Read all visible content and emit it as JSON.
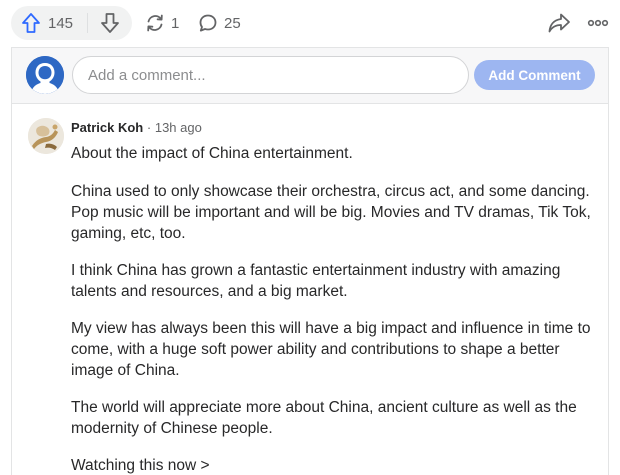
{
  "actions": {
    "upvote_count": "145",
    "share_count": "1",
    "comment_count": "25"
  },
  "composer": {
    "placeholder": "Add a comment...",
    "button_label": "Add Comment"
  },
  "comment": {
    "author": "Patrick Koh",
    "separator": "·",
    "time": "13h ago",
    "paragraphs": [
      "About the impact of China entertainment.",
      "China used to only showcase their orchestra, circus act, and some dancing. Pop music will be important and will be big. Movies and TV dramas, Tik Tok, gaming, etc, too.",
      "I think China has grown a fantastic entertainment industry with amazing talents and resources, and a big market.",
      "My view has always been this will have a big impact and influence in time to come, with a huge soft power ability and contributions to shape a better image of China.",
      "The world will appreciate more about China, ancient culture as well as the modernity of Chinese people."
    ],
    "watch_link": "Watching this now >"
  },
  "icons": {
    "upvote": "arrow-up-icon",
    "downvote": "arrow-down-icon",
    "share": "reshare-icon",
    "comments": "comment-bubble-icon",
    "forward": "share-arrow-icon",
    "more": "more-dots-icon"
  },
  "colors": {
    "accent": "#2e69ff",
    "button_disabled": "#9db6f1",
    "muted_text": "#636466",
    "panel_bg": "#f7f7f8"
  }
}
